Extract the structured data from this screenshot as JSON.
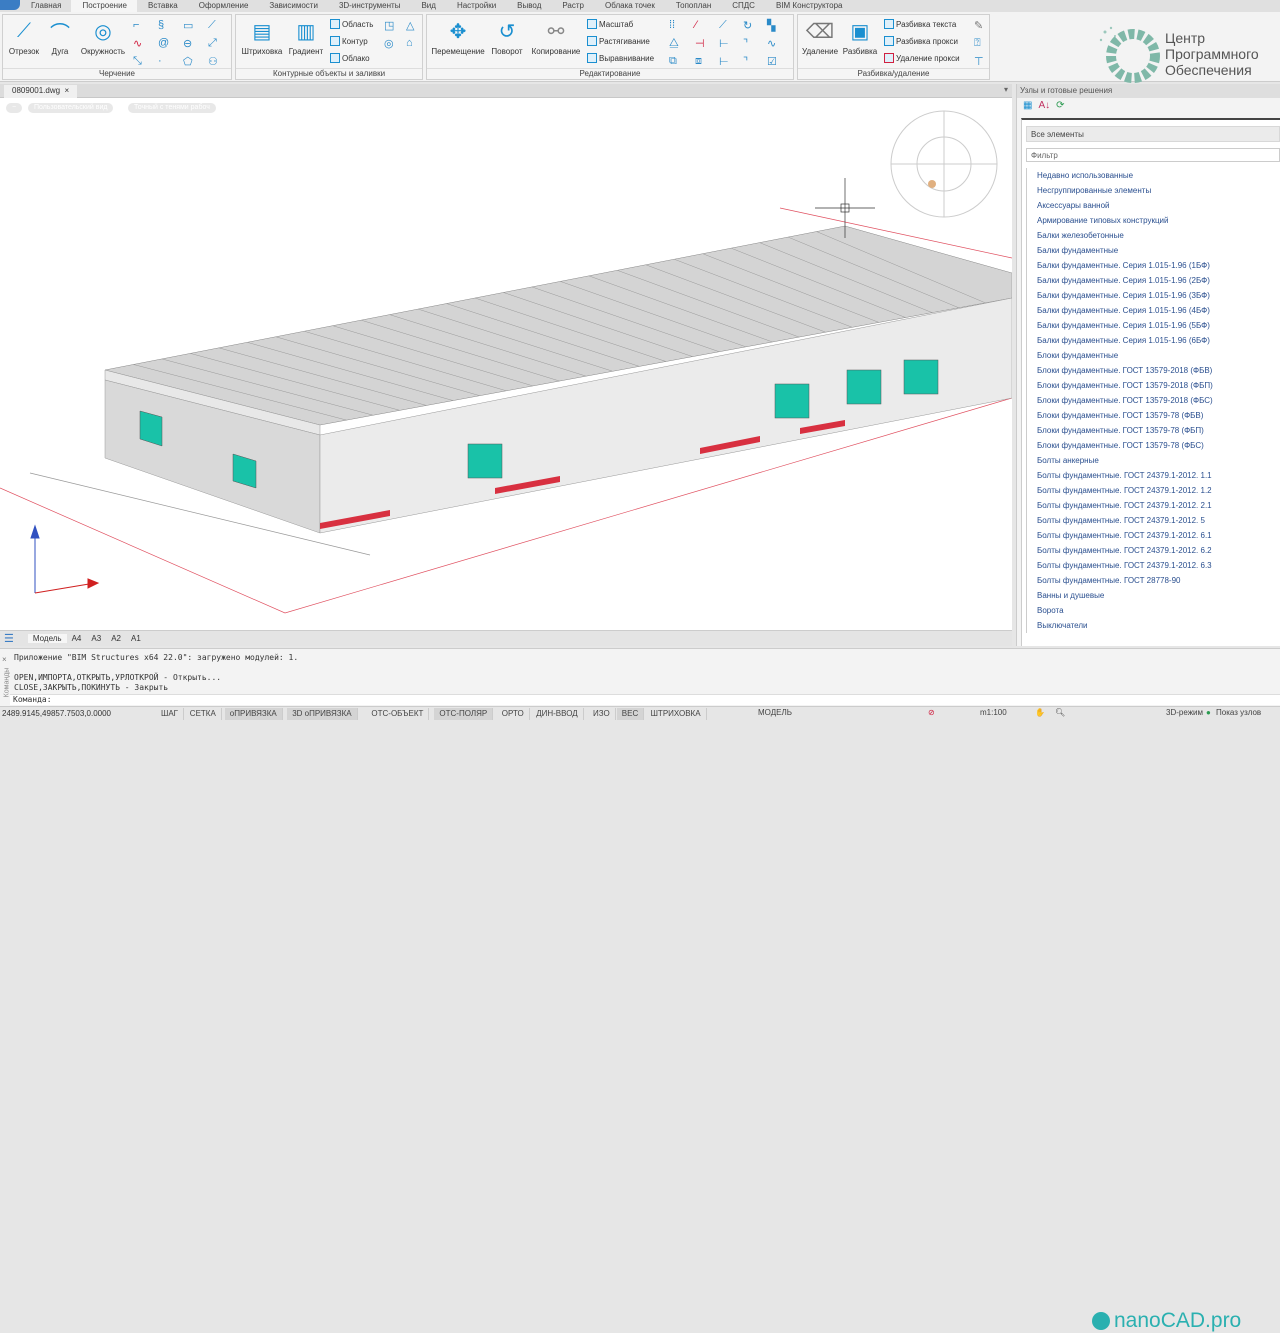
{
  "menu": {
    "tabs": [
      "Главная",
      "Построение",
      "Вставка",
      "Оформление",
      "Зависимости",
      "3D-инструменты",
      "Вид",
      "Настройки",
      "Вывод",
      "Растр",
      "Облака точек",
      "Топоплан",
      "СПДС",
      "BIM Конструктора"
    ],
    "active": 1
  },
  "ribbon": {
    "drawing": {
      "title": "Черчение",
      "segment": "Отрезок",
      "arc": "Дуга",
      "circle": "Окружность"
    },
    "contours": {
      "title": "Контурные объекты и заливки",
      "hatch": "Штриховка",
      "gradient": "Градиент",
      "region": "Область",
      "contour": "Контур",
      "cloud": "Облако"
    },
    "editing": {
      "title": "Редактирование",
      "move": "Перемещение",
      "rotate": "Поворот",
      "copy": "Копирование",
      "scale": "Масштаб",
      "stretch": "Растягивание",
      "align": "Выравнивание"
    },
    "explode": {
      "title": "Разбивка/удаление",
      "delete": "Удаление",
      "explode": "Разбивка",
      "explode_text": "Разбивка текста",
      "explode_proxy": "Разбивка прокси",
      "delete_proxy": "Удаление прокси"
    }
  },
  "logo": {
    "line1": "Центр",
    "line2": "Программного",
    "line3": "Обеспечения"
  },
  "document": {
    "tab": "0809001.dwg",
    "close": "×",
    "view_labels": [
      "−",
      "Пользовательский вид",
      "Точный с тенями рабоч"
    ]
  },
  "right_panel": {
    "title": "Узлы и готовые решения",
    "all": "Все элементы",
    "filter_placeholder": "Фильтр",
    "items": [
      "Недавно использованные",
      "Несгруппированные элементы",
      "Аксессуары ванной",
      "Армирование типовых конструкций",
      "Балки железобетонные",
      "Балки фундаментные",
      "Балки фундаментные. Серия 1.015-1.96 (1БФ)",
      "Балки фундаментные. Серия 1.015-1.96 (2БФ)",
      "Балки фундаментные. Серия 1.015-1.96 (3БФ)",
      "Балки фундаментные. Серия 1.015-1.96 (4БФ)",
      "Балки фундаментные. Серия 1.015-1.96 (5БФ)",
      "Балки фундаментные. Серия 1.015-1.96 (6БФ)",
      "Блоки фундаментные",
      "Блоки фундаментные. ГОСТ 13579-2018 (ФБВ)",
      "Блоки фундаментные. ГОСТ 13579-2018 (ФБП)",
      "Блоки фундаментные. ГОСТ 13579-2018 (ФБС)",
      "Блоки фундаментные. ГОСТ 13579-78 (ФБВ)",
      "Блоки фундаментные. ГОСТ 13579-78 (ФБП)",
      "Блоки фундаментные. ГОСТ 13579-78 (ФБС)",
      "Болты анкерные",
      "Болты фундаментные. ГОСТ 24379.1-2012. 1.1",
      "Болты фундаментные. ГОСТ 24379.1-2012. 1.2",
      "Болты фундаментные. ГОСТ 24379.1-2012. 2.1",
      "Болты фундаментные. ГОСТ 24379.1-2012. 5",
      "Болты фундаментные. ГОСТ 24379.1-2012. 6.1",
      "Болты фундаментные. ГОСТ 24379.1-2012. 6.2",
      "Болты фундаментные. ГОСТ 24379.1-2012. 6.3",
      "Болты фундаментные. ГОСТ 28778-90",
      "Ванны и душевые",
      "Ворота",
      "Выключатели"
    ]
  },
  "layout_tabs": [
    "Модель",
    "A4",
    "A3",
    "A2",
    "A1"
  ],
  "command": {
    "lines": [
      "Приложение \"BIM Structures x64 22.0\": загружено модулей: 1.",
      "OPEN,ИМПОРТА,ОТКРЫТЬ,УРЛОТКРОЙ - Открыть...",
      "CLOSE,ЗАКРЫТЬ,ПОКИНУТЬ - Закрыть"
    ],
    "prompt": "Команда:",
    "side_label": "Команды"
  },
  "brand": "nanoCAD.pro",
  "status": {
    "coords": "2489.9145,49857.7503,0.0000",
    "buttons": [
      {
        "l": "ШАГ",
        "on": false
      },
      {
        "l": "СЕТКА",
        "on": false
      },
      {
        "l": "оПРИВЯЗКА",
        "on": true
      },
      {
        "l": "3D оПРИВЯЗКА",
        "on": true
      },
      {
        "l": "ОТС-ОБЪЕКТ",
        "on": false
      },
      {
        "l": "ОТС-ПОЛЯР",
        "on": true
      },
      {
        "l": "ОРТО",
        "on": false
      },
      {
        "l": "ДИН-ВВОД",
        "on": false
      },
      {
        "l": "ИЗО",
        "on": false
      },
      {
        "l": "ВЕС",
        "on": true
      },
      {
        "l": "ШТРИХОВКА",
        "on": false
      }
    ],
    "model": "МОДЕЛЬ",
    "scale": "m1:100",
    "mode3d": "3D-режим",
    "show_nodes": "Показ узлов"
  },
  "colors": {
    "accent": "#1a8fd0",
    "brand": "#2ab0b0",
    "window": "#19c2a8"
  }
}
